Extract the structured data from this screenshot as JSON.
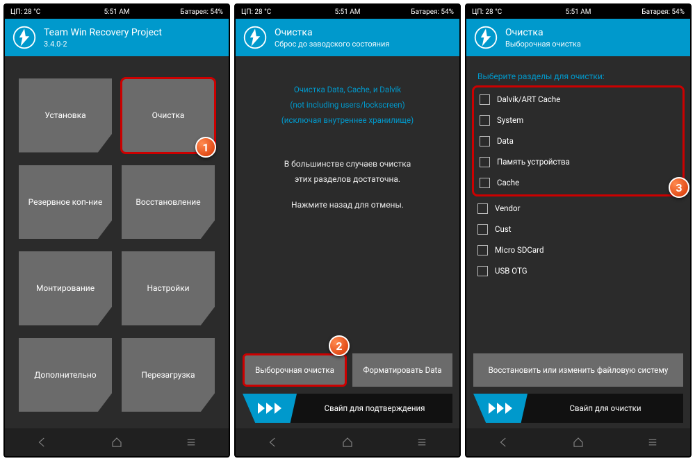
{
  "status": {
    "cpu": "ЦП: 28 °C",
    "time": "5:51 AM",
    "battery": "Батарея: 54%"
  },
  "screen1": {
    "title": "Team Win Recovery Project",
    "version": "3.4.0-2",
    "buttons": [
      "Установка",
      "Очистка",
      "Резервное коп-ние",
      "Восстановление",
      "Монтирование",
      "Настройки",
      "Дополнительно",
      "Перезагрузка"
    ]
  },
  "screen2": {
    "title": "Очистка",
    "subtitle": "Сброс до заводского состояния",
    "info1": "Очистка Data, Cache, и Dalvik",
    "info2": "(not including users/lockscreen)",
    "info3": "(исключая внутреннее хранилище)",
    "msg1": "В большинстве случаев очистка",
    "msg2": "этих разделов достаточна.",
    "msg3": "Нажмите назад для отмены.",
    "btn1": "Выборочная очистка",
    "btn2": "Форматировать Data",
    "swipe": "Свайп для подтверждения"
  },
  "screen3": {
    "title": "Очистка",
    "subtitle": "Выборочная очистка",
    "select_label": "Выберите разделы для очистки:",
    "partitions": [
      "Dalvik/ART Cache",
      "System",
      "Data",
      "Память устройства",
      "Cache",
      "Vendor",
      "Cust",
      "Micro SDCard",
      "USB OTG"
    ],
    "btn": "Восстановить или изменить файловую систему",
    "swipe": "Свайп для очистки"
  },
  "badges": {
    "b1": "1",
    "b2": "2",
    "b3": "3"
  }
}
